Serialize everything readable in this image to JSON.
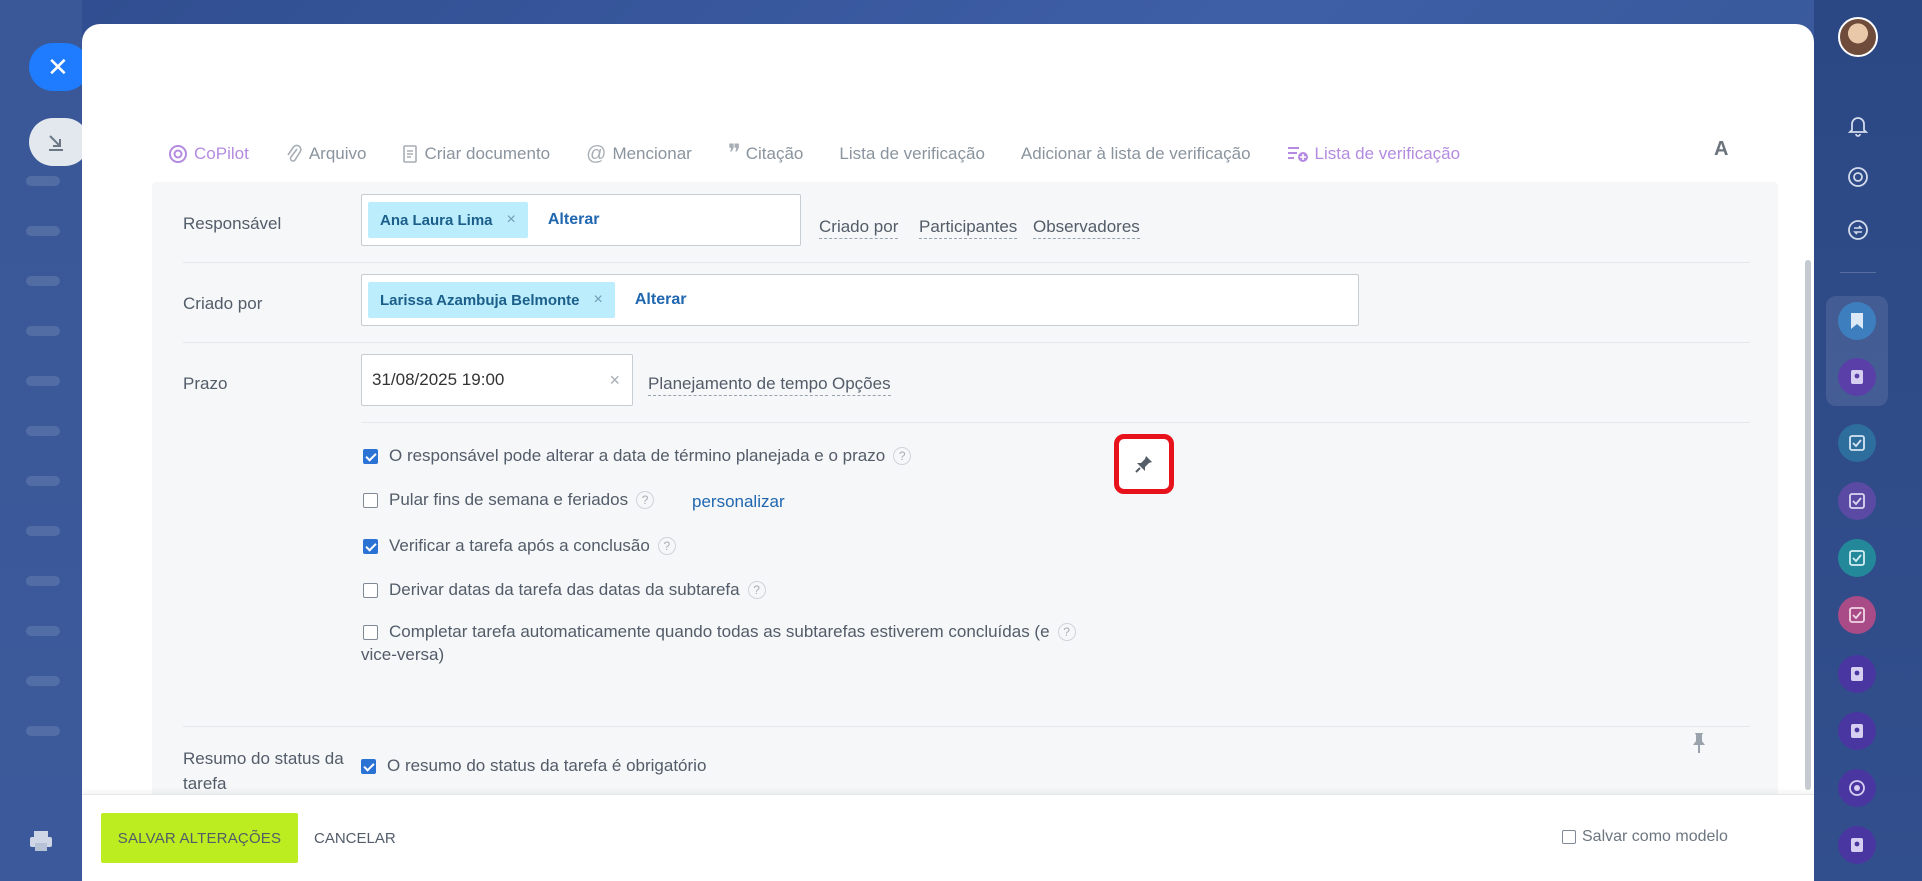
{
  "toolbar": {
    "items": [
      {
        "label": "CoPilot",
        "icon": "copilot-icon"
      },
      {
        "label": "Arquivo",
        "icon": "paperclip-icon"
      },
      {
        "label": "Criar documento",
        "icon": "document-icon"
      },
      {
        "label": "Mencionar",
        "icon": "at-icon"
      },
      {
        "label": "Citação",
        "icon": "quote-icon"
      },
      {
        "label": "Lista de verificação",
        "icon": ""
      },
      {
        "label": "Adicionar à lista de verificação",
        "icon": ""
      },
      {
        "label": "Lista de verificação",
        "icon": "checklist-add-icon"
      }
    ],
    "font_button": "A"
  },
  "responsible": {
    "label": "Responsável",
    "tag": "Ana Laura Lima",
    "tag_remove": "×",
    "change": "Alterar",
    "links": [
      "Criado por",
      "Participantes",
      "Observadores"
    ]
  },
  "created_by": {
    "label": "Criado por",
    "tag": "Larissa Azambuja Belmonte",
    "tag_remove": "×",
    "change": "Alterar"
  },
  "deadline": {
    "label": "Prazo",
    "value": "31/08/2025 19:00",
    "clear": "×",
    "links": [
      "Planejamento de tempo",
      "Opções"
    ]
  },
  "options": [
    {
      "label": "O responsável pode alterar a data de término planejada e o prazo",
      "checked": true
    },
    {
      "label": "Pular fins de semana e feriados",
      "checked": false,
      "extra_link": "personalizar"
    },
    {
      "label": "Verificar a tarefa após a conclusão",
      "checked": true
    },
    {
      "label": "Derivar datas da tarefa das datas da subtarefa",
      "checked": false
    },
    {
      "label_line1": "Completar tarefa automaticamente quando todas as subtarefas estiverem concluídas (e",
      "label_line2": "vice-versa)",
      "checked": false
    }
  ],
  "help_mark": "?",
  "status_summary": {
    "label_line1": "Resumo do status da",
    "label_line2": "tarefa",
    "option": "O resumo do status da tarefa é obrigatório",
    "checked": true
  },
  "footer": {
    "save": "SALVAR ALTERAÇÕES",
    "cancel": "CANCELAR",
    "save_template": "Salvar como modelo"
  },
  "colors": {
    "save_button": "#bbed21",
    "link_blue": "#2067b0",
    "tag_bg": "#bcedfc",
    "highlight_red": "#e8121c",
    "checkbox_blue": "#2a72d4"
  }
}
